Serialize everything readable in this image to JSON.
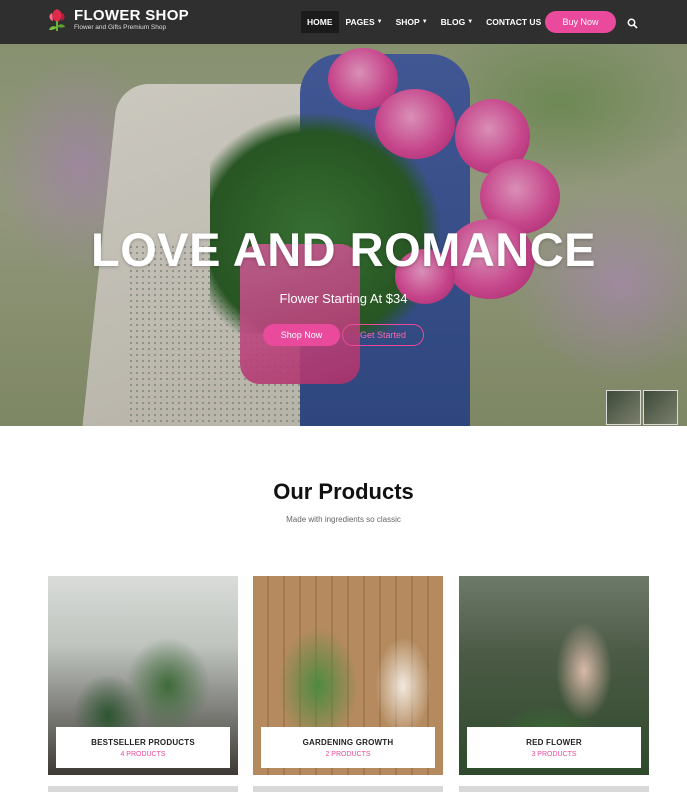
{
  "brand": {
    "name": "FLOWER SHOP",
    "tagline": "Flower and Gifts Premium Shop"
  },
  "nav": {
    "items": [
      {
        "label": "HOME",
        "active": true,
        "dropdown": false
      },
      {
        "label": "PAGES",
        "active": false,
        "dropdown": true
      },
      {
        "label": "SHOP",
        "active": false,
        "dropdown": true
      },
      {
        "label": "BLOG",
        "active": false,
        "dropdown": true
      },
      {
        "label": "CONTACT US",
        "active": false,
        "dropdown": false
      }
    ],
    "cta_label": "Buy Now",
    "search_icon": "search-icon"
  },
  "hero": {
    "title": "LOVE AND ROMANCE",
    "subtitle": "Flower Starting At $34",
    "primary_button": "Shop Now",
    "secondary_button": "Get Started"
  },
  "products_section": {
    "title": "Our Products",
    "subtitle": "Made with ingredients so classic",
    "cards": [
      {
        "title": "BESTSELLER PRODUCTS",
        "count": "4 PRODUCTS"
      },
      {
        "title": "GARDENING GROWTH",
        "count": "2 PRODUCTS"
      },
      {
        "title": "RED FLOWER",
        "count": "3 PRODUCTS"
      }
    ]
  },
  "colors": {
    "accent": "#e94a9b",
    "navbar": "#2f2f2f"
  }
}
